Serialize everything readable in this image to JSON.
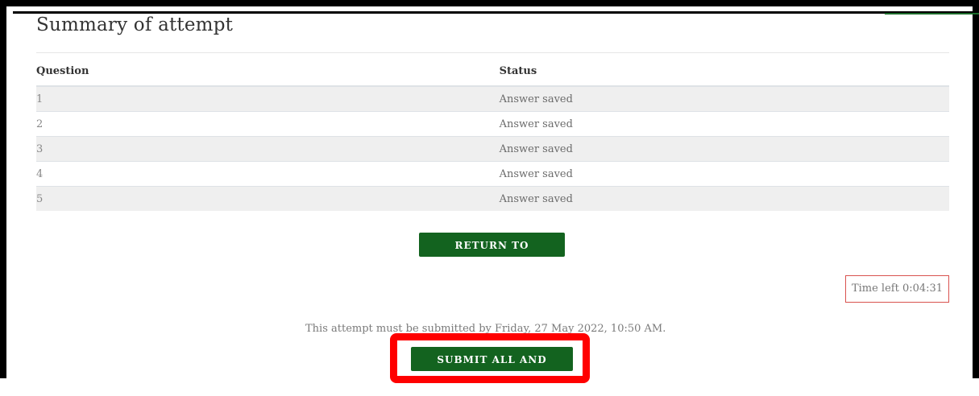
{
  "page": {
    "title": "Summary of attempt"
  },
  "table": {
    "headers": [
      "Question",
      "Status"
    ],
    "rows": [
      {
        "question": "1",
        "status": "Answer saved"
      },
      {
        "question": "2",
        "status": "Answer saved"
      },
      {
        "question": "3",
        "status": "Answer saved"
      },
      {
        "question": "4",
        "status": "Answer saved"
      },
      {
        "question": "5",
        "status": "Answer saved"
      }
    ]
  },
  "actions": {
    "return_label": "RETURN TO ATTEMPT",
    "submit_label": "SUBMIT ALL AND FINISH"
  },
  "timer": {
    "text": "Time left 0:04:31"
  },
  "deadline": {
    "text": "This attempt must be submitted by Friday, 27 May 2022, 10:50 AM."
  },
  "colors": {
    "button_green": "#13631f",
    "highlight_red": "#ff0000",
    "timer_border": "#d9534f"
  }
}
